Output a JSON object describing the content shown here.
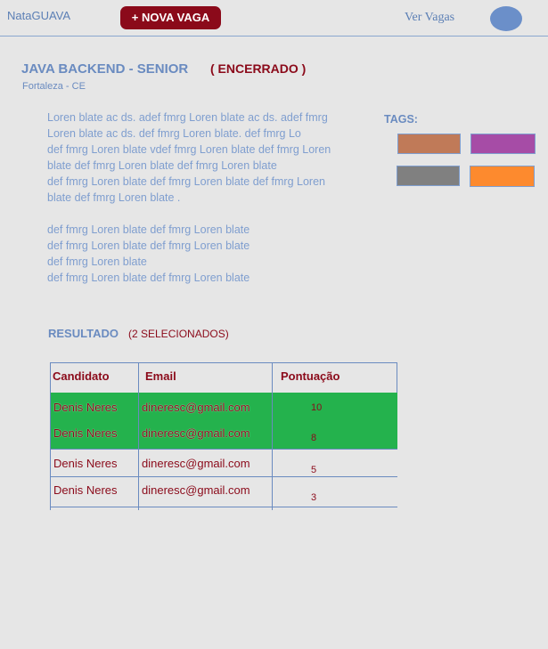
{
  "header": {
    "brand": "NataGUAVA",
    "new_button": "+ NOVA VAGA",
    "ver_vagas": "Ver Vagas"
  },
  "job": {
    "title": "JAVA BACKEND - SENIOR",
    "status": "( ENCERRADO )",
    "location": "Fortaleza - CE",
    "description_lines": [
      "Loren blate ac ds. adef fmrg Loren blate ac ds. adef fmrg",
      "Loren blate ac ds. def fmrg Loren blate. def fmrg Lo",
      "def fmrg Loren blate  vdef fmrg Loren blate def fmrg Loren",
      "blate def fmrg Loren blate def fmrg Loren blate",
      "def fmrg Loren blate def fmrg Loren blate def fmrg Loren",
      "blate def fmrg Loren blate .",
      "",
      "def fmrg Loren blate def fmrg Loren blate",
      "def fmrg Loren blate def fmrg Loren blate",
      "def fmrg Loren blate",
      "def fmrg Loren blate def fmrg Loren blate"
    ]
  },
  "tags": {
    "label": "TAGS:",
    "colors": [
      "#c07a58",
      "#a64ca6",
      "#808080",
      "#fd8a2e"
    ]
  },
  "results": {
    "label": "RESULTADO",
    "selected": "(2 SELECIONADOS)",
    "selected_color": "#24b24d",
    "columns": [
      "Candidato",
      "Email",
      "Pontuação"
    ],
    "rows": [
      {
        "name": "Denis Neres",
        "email": "dineresc@gmail.com",
        "score": "10",
        "selected": true
      },
      {
        "name": "Denis Neres",
        "email": "dineresc@gmail.com",
        "score": "8",
        "selected": true
      },
      {
        "name": "Denis Neres",
        "email": "dineresc@gmail.com",
        "score": "5",
        "selected": false
      },
      {
        "name": "Denis Neres",
        "email": "dineresc@gmail.com",
        "score": "3",
        "selected": false
      }
    ]
  }
}
